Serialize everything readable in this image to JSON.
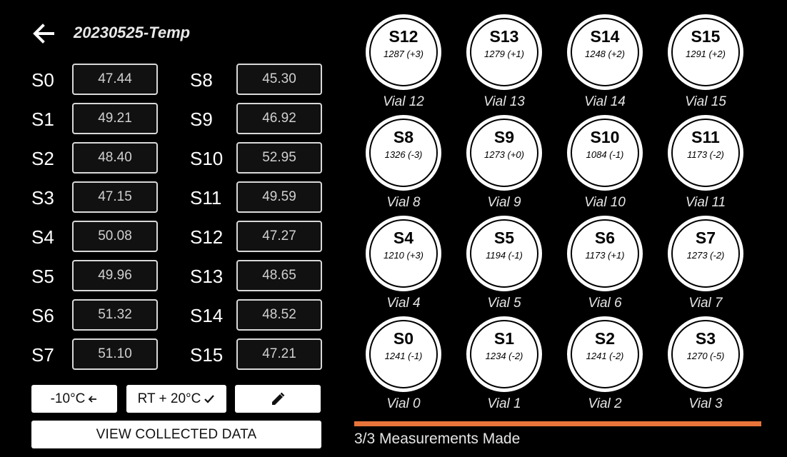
{
  "header": {
    "title": "20230525-Temp"
  },
  "sensors_left": [
    {
      "label": "S0",
      "value": "47.44"
    },
    {
      "label": "S1",
      "value": "49.21"
    },
    {
      "label": "S2",
      "value": "48.40"
    },
    {
      "label": "S3",
      "value": "47.15"
    },
    {
      "label": "S4",
      "value": "50.08"
    },
    {
      "label": "S5",
      "value": "49.96"
    },
    {
      "label": "S6",
      "value": "51.32"
    },
    {
      "label": "S7",
      "value": "51.10"
    }
  ],
  "sensors_right": [
    {
      "label": "S8",
      "value": "45.30"
    },
    {
      "label": "S9",
      "value": "46.92"
    },
    {
      "label": "S10",
      "value": "52.95"
    },
    {
      "label": "S11",
      "value": "49.59"
    },
    {
      "label": "S12",
      "value": "47.27"
    },
    {
      "label": "S13",
      "value": "48.65"
    },
    {
      "label": "S14",
      "value": "48.52"
    },
    {
      "label": "S15",
      "value": "47.21"
    }
  ],
  "buttons": {
    "cold_label": "-10°C",
    "cold_icon": "arrow-left-icon",
    "rt_label": "RT + 20°C",
    "rt_icon": "checkmark-icon",
    "edit_icon": "pencil-icon",
    "view_label": "VIEW COLLECTED DATA"
  },
  "vials": [
    {
      "name": "S12",
      "reading": "1287 (+3)",
      "caption": "Vial 12"
    },
    {
      "name": "S13",
      "reading": "1279 (+1)",
      "caption": "Vial 13"
    },
    {
      "name": "S14",
      "reading": "1248 (+2)",
      "caption": "Vial 14"
    },
    {
      "name": "S15",
      "reading": "1291 (+2)",
      "caption": "Vial 15"
    },
    {
      "name": "S8",
      "reading": "1326 (-3)",
      "caption": "Vial 8"
    },
    {
      "name": "S9",
      "reading": "1273 (+0)",
      "caption": "Vial 9"
    },
    {
      "name": "S10",
      "reading": "1084 (-1)",
      "caption": "Vial 10"
    },
    {
      "name": "S11",
      "reading": "1173 (-2)",
      "caption": "Vial 11"
    },
    {
      "name": "S4",
      "reading": "1210 (+3)",
      "caption": "Vial 4"
    },
    {
      "name": "S5",
      "reading": "1194 (-1)",
      "caption": "Vial 5"
    },
    {
      "name": "S6",
      "reading": "1173 (+1)",
      "caption": "Vial 6"
    },
    {
      "name": "S7",
      "reading": "1273 (-2)",
      "caption": "Vial 7"
    },
    {
      "name": "S0",
      "reading": "1241 (-1)",
      "caption": "Vial 0"
    },
    {
      "name": "S1",
      "reading": "1234 (-2)",
      "caption": "Vial 1"
    },
    {
      "name": "S2",
      "reading": "1241 (-2)",
      "caption": "Vial 2"
    },
    {
      "name": "S3",
      "reading": "1270 (-5)",
      "caption": "Vial 3"
    }
  ],
  "progress": {
    "text": "3/3 Measurements Made",
    "fraction": 1.0,
    "color": "#e8743a"
  }
}
